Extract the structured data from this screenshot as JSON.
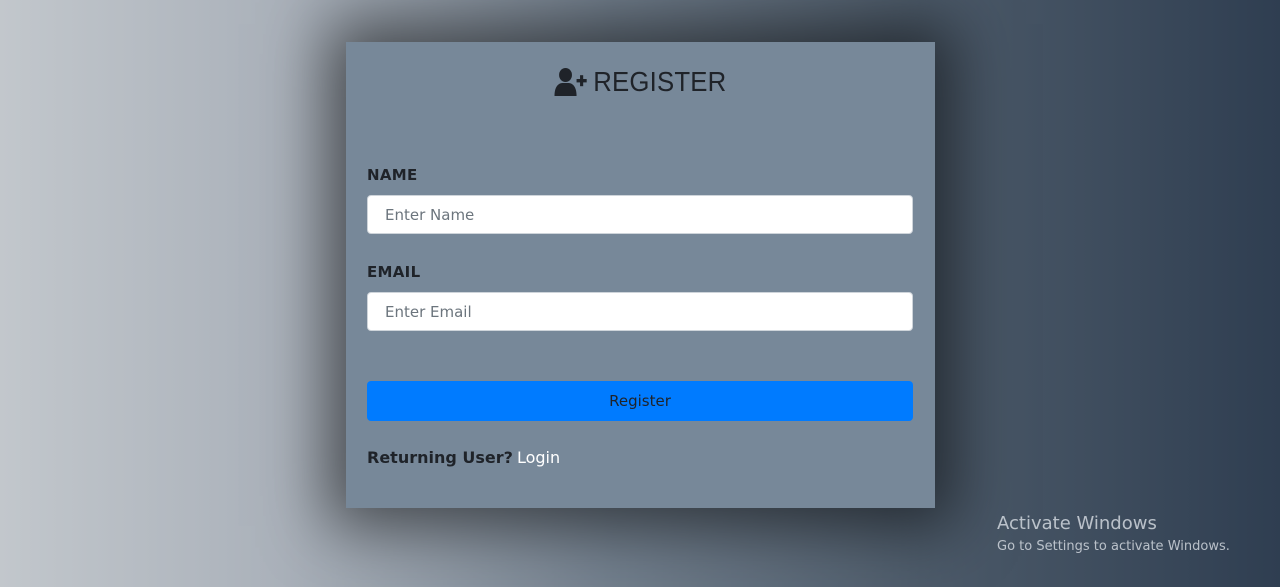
{
  "colors": {
    "card_background": "#778899",
    "button": "#007bff",
    "login_link": "#ffffff",
    "text_dark": "#1f2329"
  },
  "header": {
    "icon": "user-plus-icon",
    "title": "REGISTER"
  },
  "form": {
    "name_label": "NAME",
    "name_placeholder": "Enter Name",
    "name_value": "",
    "email_label": "EMAIL",
    "email_placeholder": "Enter Email",
    "email_value": "",
    "submit_label": "Register"
  },
  "footer": {
    "prompt": "Returning User?",
    "login_link": "Login"
  },
  "watermark": {
    "title": "Activate Windows",
    "subtitle": "Go to Settings to activate Windows."
  }
}
